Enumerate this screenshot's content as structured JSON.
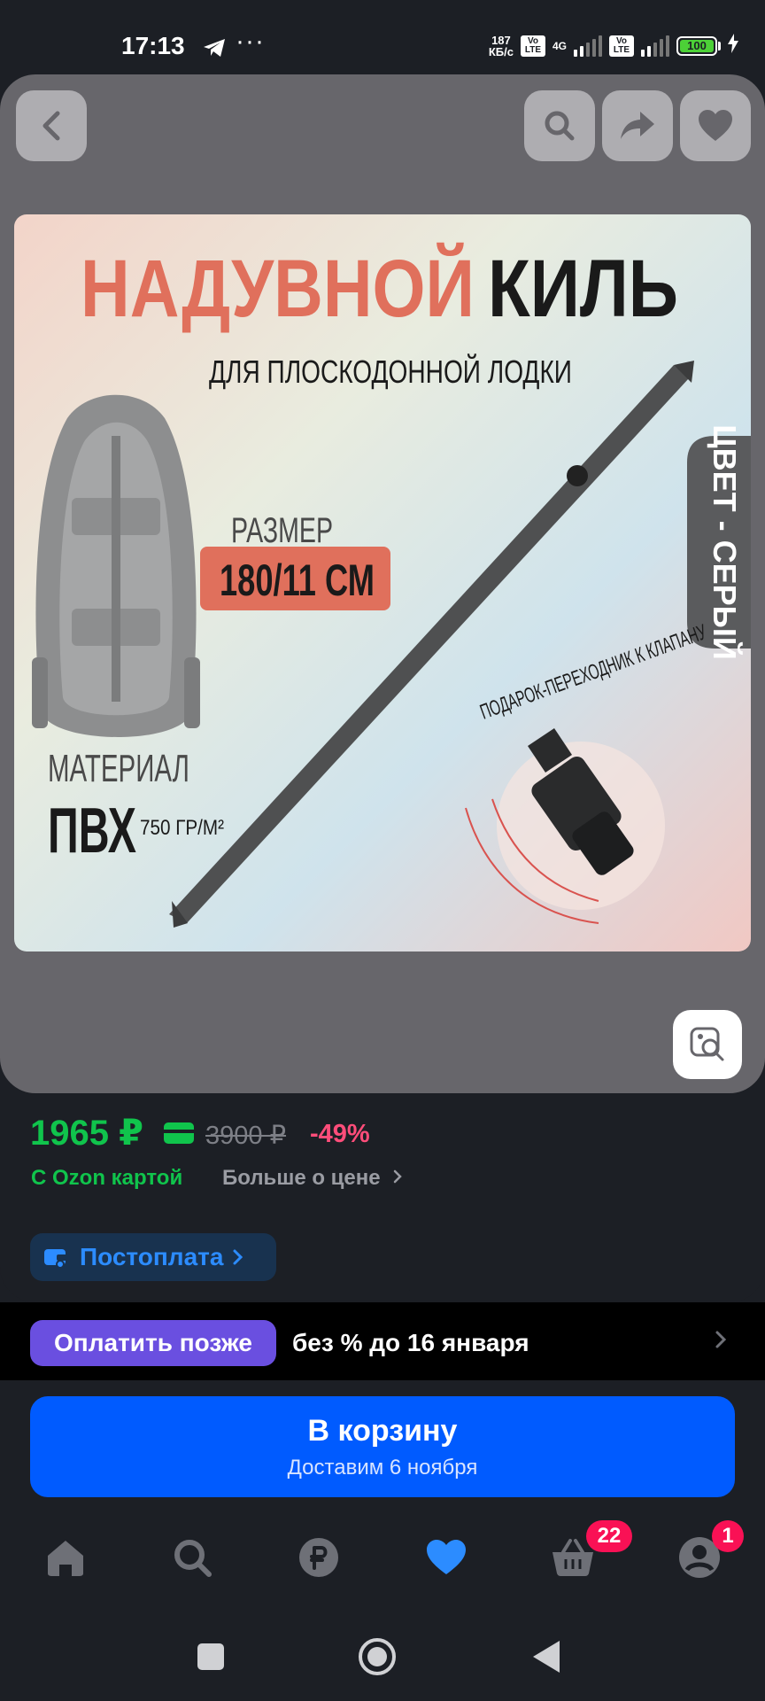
{
  "status_bar": {
    "time": "17:13",
    "dots": "···",
    "speed_value": "187",
    "speed_unit": "КБ/с",
    "volte": "Vo LTE",
    "network": "4G",
    "battery": "100"
  },
  "product_image": {
    "title_part1": "НАДУВНОЙ",
    "title_part2": "КИЛЬ",
    "subtitle": "ДЛЯ ПЛОСКОДОННОЙ ЛОДКИ",
    "size_label": "РАЗМЕР",
    "size_value": "180/11 СМ",
    "material_label": "МАТЕРИАЛ",
    "material_value": "ПВХ",
    "material_density": "750 ГР/М²",
    "color_tab": "ЦВЕТ - СЕРЫЙ",
    "gift_text": "ПОДАРОК-ПЕРЕХОДНИК К КЛАПАНУ"
  },
  "price": {
    "current": "1965 ₽",
    "old": "3900 ₽",
    "discount": "-49%",
    "card_note": "С Ozon картой",
    "more_link": "Больше о цене"
  },
  "postpay": {
    "label": "Постоплата"
  },
  "pay_later": {
    "badge": "Оплатить позже",
    "text": "без % до 16 января"
  },
  "cart_button": {
    "label": "В корзину",
    "delivery": "Доставим 6 ноября"
  },
  "bottom_nav": {
    "cart_badge": "22",
    "profile_badge": "1"
  },
  "colors": {
    "accent_blue": "#005bff",
    "price_green": "#10c44c",
    "discount_pink": "#ff4d7a",
    "pay_later_purple": "#6a4fe0",
    "badge_red": "#f91155"
  }
}
